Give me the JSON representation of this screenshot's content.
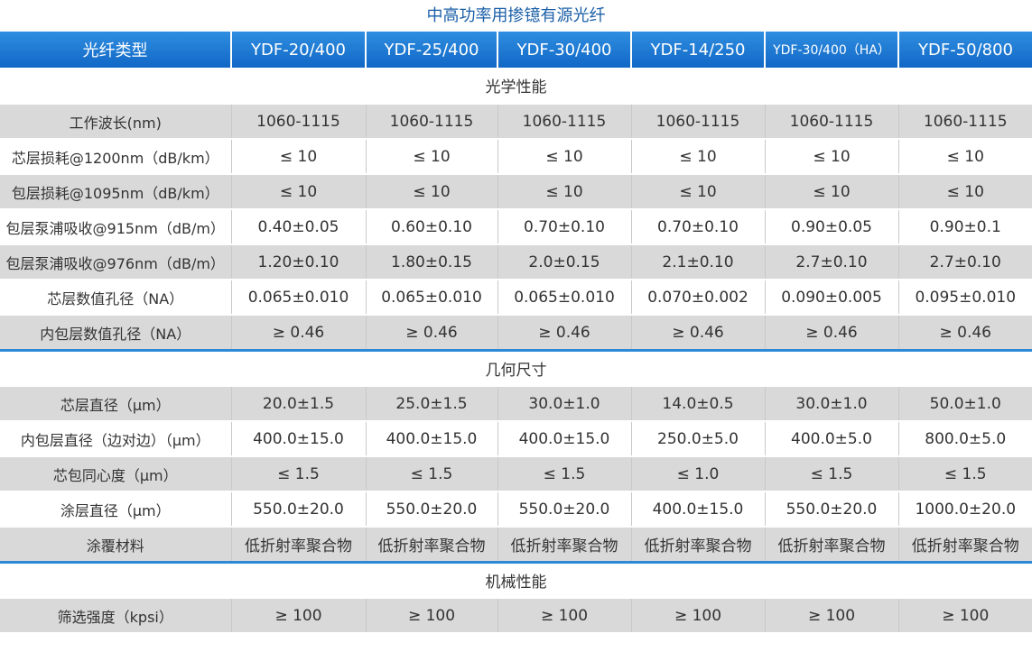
{
  "title": "中高功率用掺镱有源光纤",
  "header": [
    "光纤类型",
    "YDF-20/400",
    "YDF-25/400",
    "YDF-30/400",
    "YDF-14/250",
    "YDF-30/400（HA）",
    "YDF-50/800"
  ],
  "sections": [
    {
      "name": "光学性能",
      "rows": [
        {
          "label": "工作波长(nm)",
          "values": [
            "1060-1115",
            "1060-1115",
            "1060-1115",
            "1060-1115",
            "1060-1115",
            "1060-1115"
          ]
        },
        {
          "label": "芯层损耗@1200nm（dB/km）",
          "values": [
            "≤ 10",
            "≤ 10",
            "≤ 10",
            "≤ 10",
            "≤ 10",
            "≤ 10"
          ]
        },
        {
          "label": "包层损耗@1095nm（dB/km）",
          "values": [
            "≤ 10",
            "≤ 10",
            "≤ 10",
            "≤ 10",
            "≤ 10",
            "≤ 10"
          ]
        },
        {
          "label": "包层泵浦吸收@915nm（dB/m）",
          "values": [
            "0.40±0.05",
            "0.60±0.10",
            "0.70±0.10",
            "0.70±0.10",
            "0.90±0.05",
            "0.90±0.1"
          ]
        },
        {
          "label": "包层泵浦吸收@976nm（dB/m）",
          "values": [
            "1.20±0.10",
            "1.80±0.15",
            "2.0±0.15",
            "2.1±0.10",
            "2.7±0.10",
            "2.7±0.10"
          ]
        },
        {
          "label": "芯层数值孔径（NA）",
          "values": [
            "0.065±0.010",
            "0.065±0.010",
            "0.065±0.010",
            "0.070±0.002",
            "0.090±0.005",
            "0.095±0.010"
          ]
        },
        {
          "label": "内包层数值孔径（NA）",
          "values": [
            "≥ 0.46",
            "≥ 0.46",
            "≥ 0.46",
            "≥ 0.46",
            "≥ 0.46",
            "≥ 0.46"
          ]
        }
      ]
    },
    {
      "name": "几何尺寸",
      "rows": [
        {
          "label": "芯层直径（μm）",
          "values": [
            "20.0±1.5",
            "25.0±1.5",
            "30.0±1.0",
            "14.0±0.5",
            "30.0±1.0",
            "50.0±1.0"
          ]
        },
        {
          "label": "内包层直径（边对边）（μm）",
          "values": [
            "400.0±15.0",
            "400.0±15.0",
            "400.0±15.0",
            "250.0±5.0",
            "400.0±5.0",
            "800.0±5.0"
          ]
        },
        {
          "label": "芯包同心度（μm）",
          "values": [
            "≤ 1.5",
            "≤ 1.5",
            "≤ 1.5",
            "≤ 1.0",
            "≤ 1.5",
            "≤ 1.5"
          ]
        },
        {
          "label": "涂层直径（μm）",
          "values": [
            "550.0±20.0",
            "550.0±20.0",
            "550.0±20.0",
            "400.0±15.0",
            "550.0±20.0",
            "1000.0±20.0"
          ]
        },
        {
          "label": "涂覆材料",
          "values": [
            "低折射率聚合物",
            "低折射率聚合物",
            "低折射率聚合物",
            "低折射率聚合物",
            "低折射率聚合物",
            "低折射率聚合物"
          ]
        }
      ]
    },
    {
      "name": "机械性能",
      "rows": [
        {
          "label": "筛选强度（kpsi）",
          "values": [
            "≥ 100",
            "≥ 100",
            "≥ 100",
            "≥ 100",
            "≥ 100",
            "≥ 100"
          ]
        }
      ]
    }
  ]
}
